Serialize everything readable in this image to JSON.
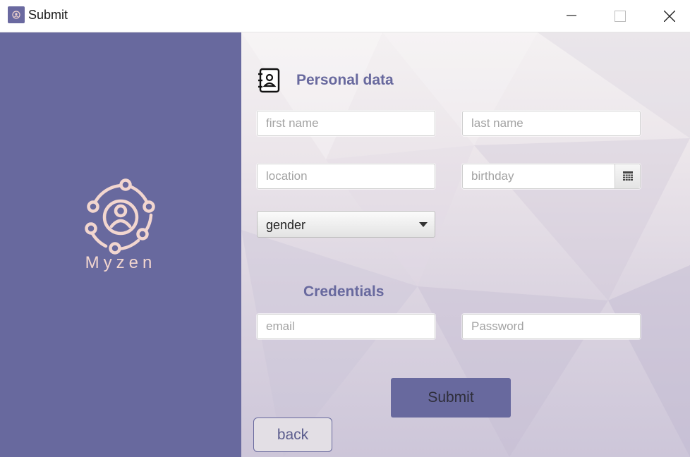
{
  "window": {
    "title": "Submit",
    "app_icon": "app-logo-icon",
    "controls": [
      "minimize-icon",
      "maximize-icon",
      "close-icon"
    ]
  },
  "brand": {
    "name": "Myzen",
    "logo_icon": "network-people-icon",
    "panel_color": "#68699e",
    "logo_color": "#f2d6cf"
  },
  "personal": {
    "title": "Personal data",
    "icon": "contact-book-icon",
    "first_name_placeholder": "first name",
    "last_name_placeholder": "last name",
    "location_placeholder": "location",
    "birthday_placeholder": "birthday",
    "calendar_icon": "calendar-icon",
    "gender_value": "gender"
  },
  "credentials": {
    "title": "Credentials",
    "email_placeholder": "email",
    "password_placeholder": "Password"
  },
  "actions": {
    "submit_label": "Submit",
    "back_label": "back"
  },
  "colors": {
    "accent": "#68699e",
    "title_text": "#68699e"
  }
}
